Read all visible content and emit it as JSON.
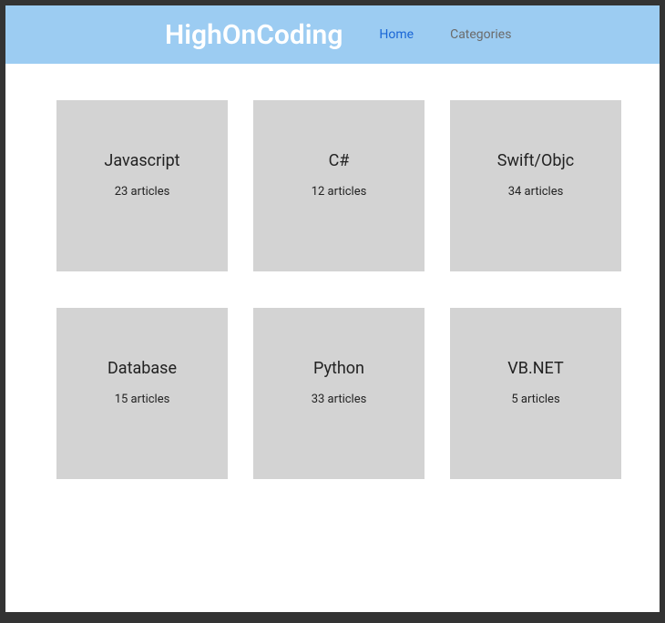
{
  "header": {
    "brand": "HighOnCoding",
    "nav": {
      "home": "Home",
      "categories": "Categories"
    }
  },
  "cards": [
    {
      "title": "Javascript",
      "subtitle": "23 articles"
    },
    {
      "title": "C#",
      "subtitle": "12 articles"
    },
    {
      "title": "Swift/Objc",
      "subtitle": "34 articles"
    },
    {
      "title": "Database",
      "subtitle": "15 articles"
    },
    {
      "title": "Python",
      "subtitle": "33 articles"
    },
    {
      "title": "VB.NET",
      "subtitle": "5 articles"
    }
  ]
}
